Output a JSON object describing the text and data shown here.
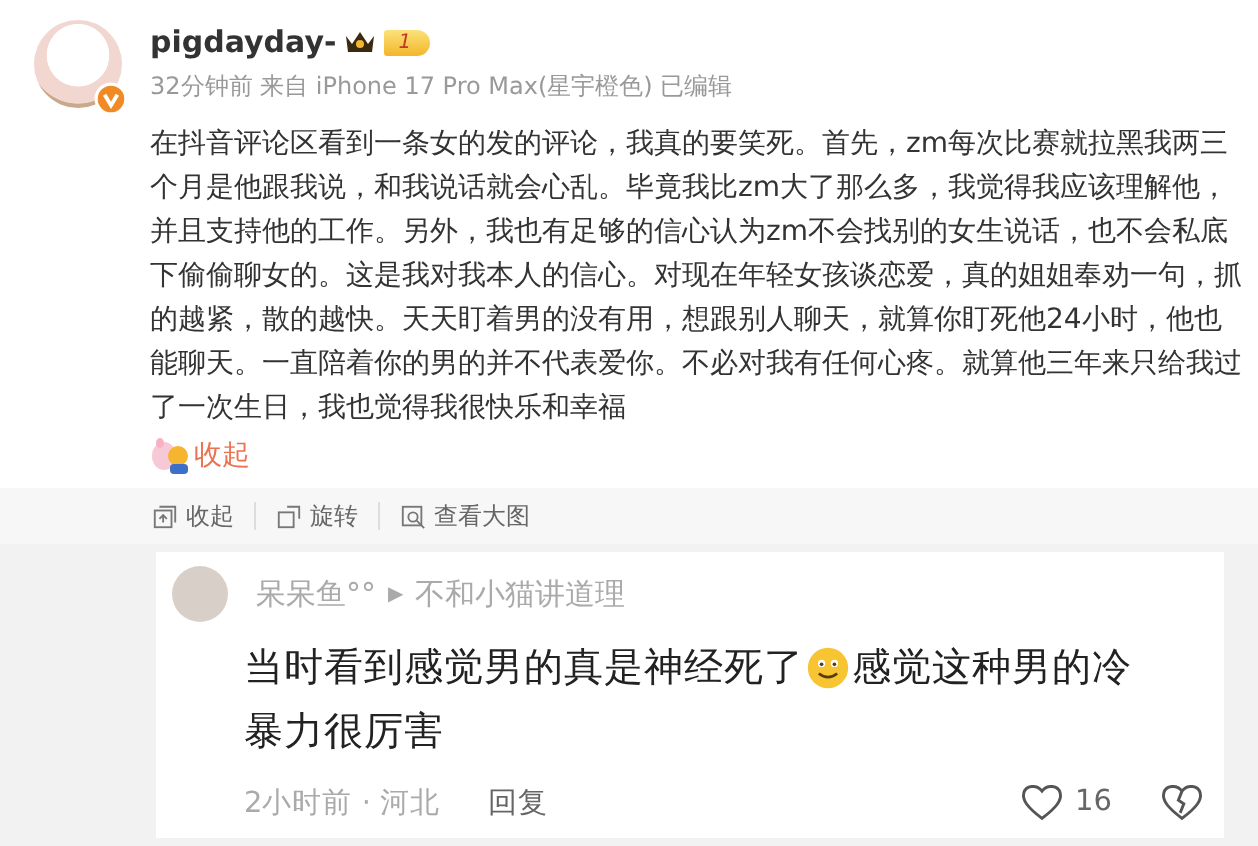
{
  "post": {
    "author": "pigdayday-",
    "vip_level": "1",
    "verified": true,
    "meta": "32分钟前 来自 iPhone 17 Pro Max(星宇橙色) 已编辑",
    "text": "在抖音评论区看到一条女的发的评论，我真的要笑死。首先，zm每次比赛就拉黑我两三个月是他跟我说，和我说话就会心乱。毕竟我比zm大了那么多，我觉得我应该理解他，并且支持他的工作。另外，我也有足够的信心认为zm不会找别的女生说话，也不会私底下偷偷聊女的。这是我对我本人的信心。对现在年轻女孩谈恋爱，真的姐姐奉劝一句，抓的越紧，散的越快。天天盯着男的没有用，想跟别人聊天，就算你盯死他24小时，他也能聊天。一直陪着你的男的并不代表爱你。不必对我有任何心疼。就算他三年来只给我过了一次生日，我也觉得我很快乐和幸福",
    "collapse_link": "收起"
  },
  "image_toolbar": [
    {
      "kind": "collapse",
      "label": "收起"
    },
    {
      "kind": "rotate",
      "label": "旋转"
    },
    {
      "kind": "zoom",
      "label": "查看大图"
    }
  ],
  "comment": {
    "author": "呆呆鱼°°",
    "reply_arrow": "▶",
    "reply_to": "不和小猫讲道理",
    "text_parts": [
      "当时看到感觉男的真是神经死了",
      "感觉这种男的冷",
      "暴力很厉害"
    ],
    "time_location": "2小时前 · 河北",
    "reply_button": "回复",
    "like_count": "16"
  }
}
